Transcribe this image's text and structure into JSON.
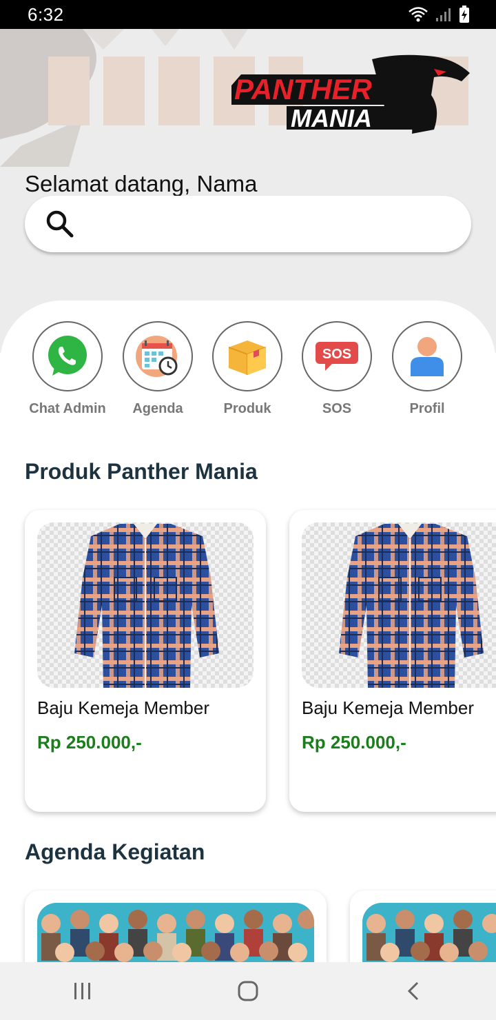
{
  "status_bar": {
    "time": "6:32"
  },
  "header": {
    "logo_text_top": "PANTHER",
    "logo_text_bottom": "MANIA",
    "greeting": "Selamat datang, Nama"
  },
  "search": {
    "placeholder": "",
    "value": ""
  },
  "menu": [
    {
      "label": "Chat Admin",
      "icon": "whatsapp-icon"
    },
    {
      "label": "Agenda",
      "icon": "calendar-icon"
    },
    {
      "label": "Produk",
      "icon": "box-icon"
    },
    {
      "label": "SOS",
      "icon": "sos-icon"
    },
    {
      "label": "Profil",
      "icon": "user-icon"
    }
  ],
  "products_section": {
    "title": "Produk Panther Mania",
    "items": [
      {
        "name": "Baju Kemeja Member",
        "price": "Rp 250.000,-"
      },
      {
        "name": "Baju Kemeja Member",
        "price": "Rp 250.000,-"
      }
    ]
  },
  "agenda_section": {
    "title": "Agenda Kegiatan"
  },
  "colors": {
    "price": "#1b7d1b",
    "section_title": "#1e3340",
    "logo_red": "#e8202a"
  }
}
